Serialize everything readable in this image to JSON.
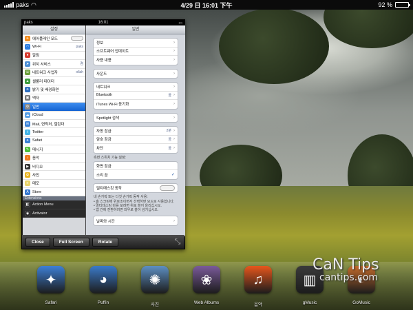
{
  "statusbar": {
    "carrier": "paks",
    "time": "4/29 日 16:01 下午",
    "battery": "92 %",
    "battery_level": 0.92
  },
  "window": {
    "status": {
      "carrier": "paks",
      "time": "16:01"
    },
    "sidebar": {
      "title": "설정",
      "items": [
        {
          "label": "에어플레인 모드",
          "value": "",
          "toggle": true,
          "color": "#f28b1c",
          "icon": "airplane-icon"
        },
        {
          "label": "Wi-Fi",
          "value": "paks",
          "color": "#2d7de0",
          "icon": "wifi-icon"
        },
        {
          "label": "알림",
          "value": "",
          "color": "#d63b2f",
          "icon": "notification-icon"
        },
        {
          "label": "위치 서비스",
          "value": "켬",
          "color": "#4b8ed6",
          "icon": "location-icon"
        },
        {
          "label": "네트워크 사업자",
          "value": "ollah",
          "color": "#6a9e3a",
          "icon": "carrier-icon"
        },
        {
          "label": "셀룰러 데이터",
          "value": "",
          "color": "#3f9e3f",
          "icon": "cellular-icon"
        },
        {
          "label": "밝기 및 배경화면",
          "value": "",
          "color": "#2f6fbf",
          "icon": "brightness-icon"
        },
        {
          "label": "액자",
          "value": "",
          "color": "#777777",
          "icon": "picture-frame-icon"
        },
        {
          "label": "일반",
          "value": "",
          "color": "#8a8a8a",
          "icon": "gear-icon",
          "selected": true
        },
        {
          "label": "iCloud",
          "value": "",
          "color": "#5aa0e6",
          "icon": "cloud-icon"
        },
        {
          "label": "Mail, 연락처, 캘린더",
          "value": "",
          "color": "#3d84d8",
          "icon": "mail-icon"
        },
        {
          "label": "Twitter",
          "value": "",
          "color": "#45b5e8",
          "icon": "twitter-icon"
        },
        {
          "label": "Safari",
          "value": "",
          "color": "#3b82d6",
          "icon": "compass-icon"
        },
        {
          "label": "메시지",
          "value": "",
          "color": "#4dbf3b",
          "icon": "message-icon"
        },
        {
          "label": "음악",
          "value": "",
          "color": "#f07a1e",
          "icon": "music-icon"
        },
        {
          "label": "비디오",
          "value": "",
          "color": "#333333",
          "icon": "video-icon"
        },
        {
          "label": "사진",
          "value": "",
          "color": "#e9b320",
          "icon": "photos-icon"
        },
        {
          "label": "메모",
          "value": "",
          "color": "#e8d36a",
          "icon": "notes-icon"
        },
        {
          "label": "Store",
          "value": "",
          "color": "#3678d0",
          "icon": "store-icon"
        }
      ],
      "section_label": "Extensions",
      "extensions": [
        {
          "label": "Action Menu",
          "color": "#2a2a2a",
          "icon": "action-menu-icon"
        },
        {
          "label": "Activator",
          "color": "#1b1b1b",
          "icon": "activator-icon"
        }
      ]
    },
    "content": {
      "title": "일반",
      "groups": [
        {
          "rows": [
            {
              "label": "정보",
              "value": "",
              "accessory": "chevron"
            },
            {
              "label": "소프트웨어 업데이트",
              "value": "",
              "accessory": "chevron"
            },
            {
              "label": "사용 내용",
              "value": "",
              "accessory": "chevron"
            }
          ]
        },
        {
          "rows": [
            {
              "label": "사운드",
              "value": "",
              "accessory": "chevron"
            }
          ]
        },
        {
          "rows": [
            {
              "label": "네트워크",
              "value": "",
              "accessory": "chevron"
            },
            {
              "label": "Bluetooth",
              "value": "끔",
              "accessory": "chevron"
            },
            {
              "label": "iTunes Wi-Fi 동기화",
              "value": "",
              "accessory": "chevron"
            }
          ]
        },
        {
          "rows": [
            {
              "label": "Spotlight 검색",
              "value": "",
              "accessory": "chevron"
            }
          ]
        },
        {
          "rows": [
            {
              "label": "자동 잠금",
              "value": "2분",
              "accessory": "chevron"
            },
            {
              "label": "암호 잠금",
              "value": "끔",
              "accessory": "chevron"
            },
            {
              "label": "차단",
              "value": "끔",
              "accessory": "chevron"
            }
          ]
        }
      ],
      "switch_note": "측면 스위치 기능 설정:",
      "switch_group": [
        {
          "label": "화면 잠금",
          "accessory": "none"
        },
        {
          "label": "소리 끔",
          "accessory": "check"
        }
      ],
      "multitask": {
        "label": "멀티태스킹 동작",
        "toggle": true
      },
      "multitask_note": [
        "네 손가락 또는 다섯 손가락 동작 사용:",
        "• 홈 스크린에 위로조이면서 선택하면 모드로 사용합니다.",
        "• 멀티태스킹 바를 보려면 위로 쓸어 올리십시오.",
        "• 앱 간에 전환하려면 좌우로 쓸어 넘기십시오."
      ],
      "date_row": {
        "label": "날짜와 시간",
        "value": "",
        "accessory": "chevron"
      }
    },
    "toolbar": {
      "close": "Close",
      "fullscreen": "Full Screen",
      "rotate": "Rotate"
    }
  },
  "dock": [
    {
      "label": "Safari",
      "icon": "compass-icon",
      "color": "#3d7fd6"
    },
    {
      "label": "Puffin",
      "icon": "puffin-icon",
      "color": "#3b7ac9"
    },
    {
      "label": "사진",
      "icon": "sunflower-icon",
      "color": "#5d8fc3"
    },
    {
      "label": "Web Albums",
      "icon": "flower-icon",
      "color": "#7a5a9a"
    },
    {
      "label": "음악",
      "icon": "music-note-icon",
      "color": "#e8561c"
    },
    {
      "label": "gMusic",
      "icon": "gmusic-icon",
      "color": "#3a3a3a"
    },
    {
      "label": "GoMusic",
      "icon": "gomusic-icon",
      "color": "#c46b2b"
    }
  ],
  "watermark": {
    "line1": "CaN Tips",
    "line2": "cantips.com"
  }
}
